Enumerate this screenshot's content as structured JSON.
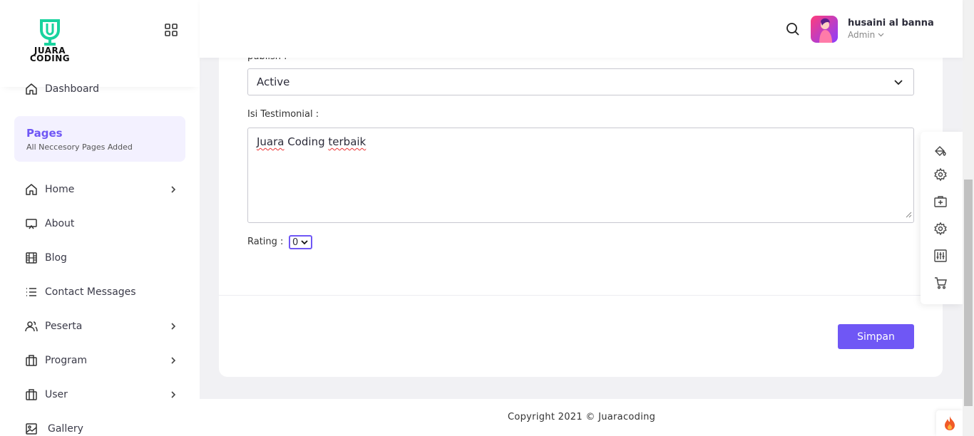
{
  "brand": {
    "logo_line1": "JUARA",
    "logo_line2": "CODING",
    "accent": "#6f57f5",
    "logo_color": "#18d39e"
  },
  "header": {
    "user_name": "husaini al banna",
    "user_role": "Admin"
  },
  "sidebar": {
    "dashboard": "Dashboard",
    "pages_title": "Pages",
    "pages_subtitle": "All Neccesory Pages Added",
    "items": [
      {
        "label": "Home",
        "icon": "home-icon",
        "has_submenu": true
      },
      {
        "label": "About",
        "icon": "monitor-icon",
        "has_submenu": false
      },
      {
        "label": "Blog",
        "icon": "film-icon",
        "has_submenu": false
      },
      {
        "label": "Contact Messages",
        "icon": "list-icon",
        "has_submenu": false
      },
      {
        "label": "Peserta",
        "icon": "users-icon",
        "has_submenu": true
      },
      {
        "label": "Program",
        "icon": "briefcase-icon",
        "has_submenu": true
      },
      {
        "label": "User",
        "icon": "briefcase-icon",
        "has_submenu": true
      },
      {
        "label": "Gallery",
        "icon": "image-icon",
        "has_submenu": false
      }
    ]
  },
  "form": {
    "publish_label": "publish :",
    "publish_value": "Active",
    "isi_label": "Isi Testimonial :",
    "isi_word1": "Juara",
    "isi_word2": " Coding ",
    "isi_word3": "terbaik",
    "rating_label": "Rating :",
    "rating_value": "0",
    "save_label": "Simpan"
  },
  "right_toolbar": [
    "paint-bucket-icon",
    "settings-icon",
    "medical-kit-icon",
    "settings-icon",
    "sliders-icon",
    "cart-icon"
  ],
  "footer": {
    "copyright": "Copyright 2021 © Juaracoding"
  }
}
